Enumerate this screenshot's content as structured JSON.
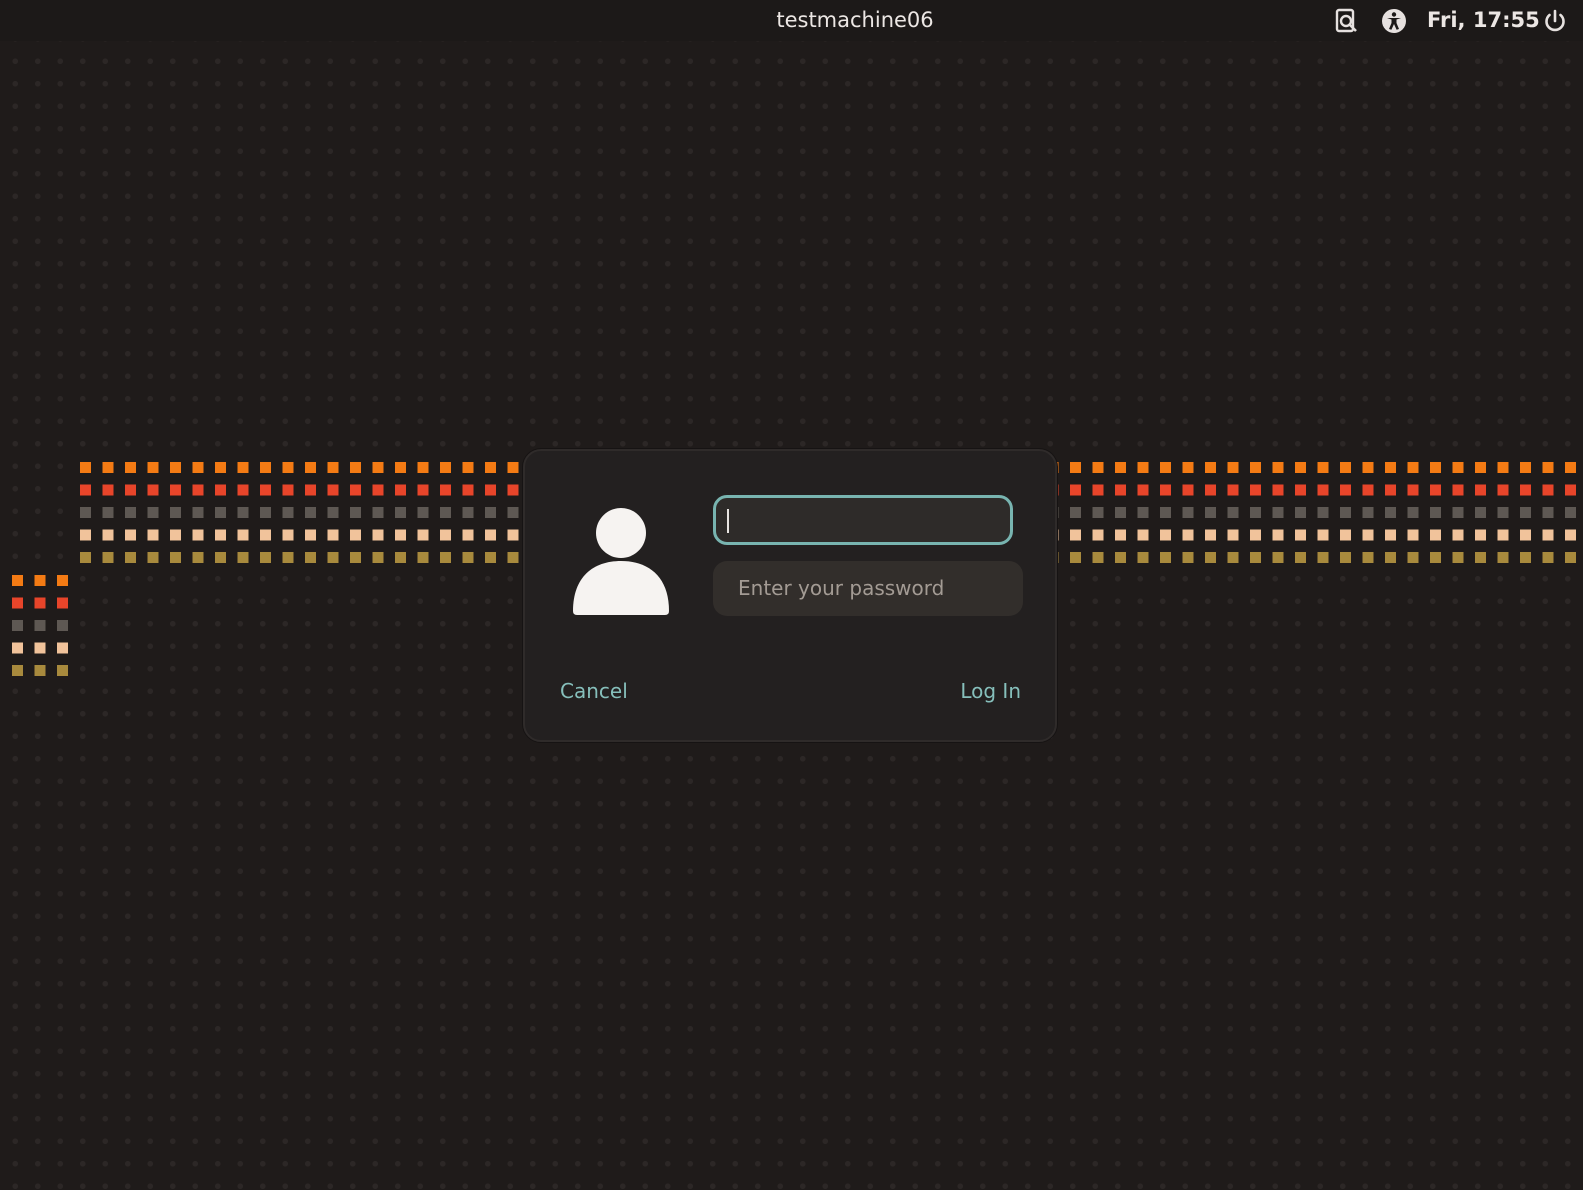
{
  "topbar": {
    "hostname": "testmachine06",
    "clock": "Fri, 17:55",
    "icons": [
      "screen-reader-icon",
      "accessibility-icon",
      "power-icon"
    ]
  },
  "dialog": {
    "username_value": "",
    "password_placeholder": "Enter your password",
    "cancel_label": "Cancel",
    "login_label": "Log In"
  },
  "colors": {
    "accent": "#86bfbb",
    "focus_border": "#78b4b0",
    "band_rows": [
      "#f47b14",
      "#e8452a",
      "#5e5853",
      "#f1c39b",
      "#a88a3d"
    ]
  }
}
